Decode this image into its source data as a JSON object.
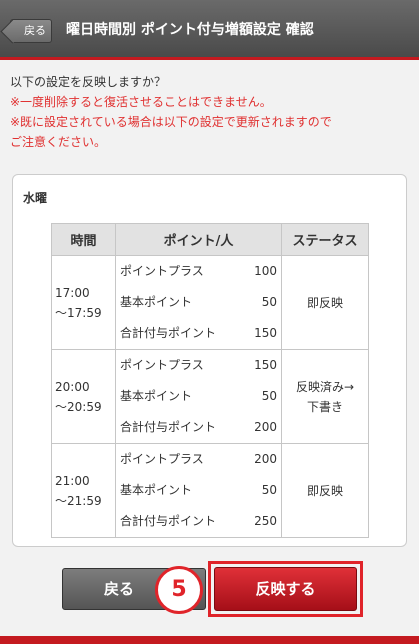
{
  "header": {
    "back_label": "戻る",
    "title": "曜日時間別 ポイント付与増額設定 確認"
  },
  "intro": {
    "question": "以下の設定を反映しますか？",
    "warning1": "※一度削除すると復活させることはできません。",
    "warning2": "※既に設定されている場合は以下の設定で更新されますので",
    "warning3": "ご注意ください。"
  },
  "card": {
    "day": "水曜",
    "columns": [
      "時間",
      "ポイント/人",
      "ステータス"
    ],
    "rows": [
      {
        "time_start": "17:00",
        "time_end": "～17:59",
        "points": [
          {
            "label": "ポイントプラス",
            "value": "100"
          },
          {
            "label": "基本ポイント",
            "value": "50"
          },
          {
            "label": "合計付与ポイント",
            "value": "150"
          }
        ],
        "status1": "即反映",
        "status2": ""
      },
      {
        "time_start": "20:00",
        "time_end": "～20:59",
        "points": [
          {
            "label": "ポイントプラス",
            "value": "150"
          },
          {
            "label": "基本ポイント",
            "value": "50"
          },
          {
            "label": "合計付与ポイント",
            "value": "200"
          }
        ],
        "status1": "反映済み→",
        "status2": "下書き"
      },
      {
        "time_start": "21:00",
        "time_end": "～21:59",
        "points": [
          {
            "label": "ポイントプラス",
            "value": "200"
          },
          {
            "label": "基本ポイント",
            "value": "50"
          },
          {
            "label": "合計付与ポイント",
            "value": "250"
          }
        ],
        "status1": "即反映",
        "status2": ""
      }
    ]
  },
  "actions": {
    "back_label": "戻る",
    "step_number": "5",
    "apply_label": "反映する"
  },
  "colors": {
    "accent_red": "#e0242a",
    "warning_red": "#e03030",
    "header_gray": "#555555"
  }
}
